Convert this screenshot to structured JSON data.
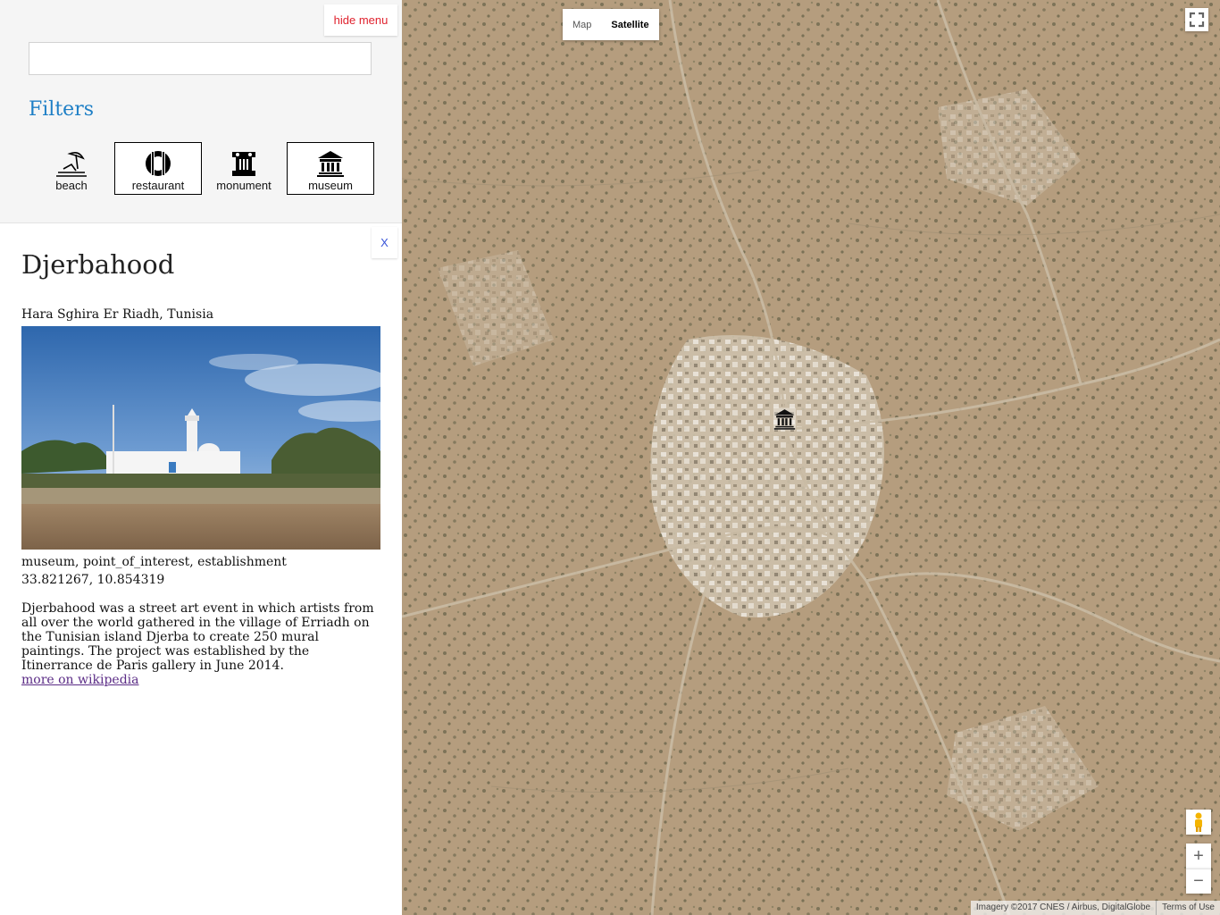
{
  "menu": {
    "hide_label": "hide menu",
    "search_value": "",
    "search_placeholder": "",
    "filters_title": "Filters",
    "filters": [
      {
        "label": "beach",
        "icon": "beach-umbrella-icon",
        "active": false
      },
      {
        "label": "restaurant",
        "icon": "cutlery-icon",
        "active": true
      },
      {
        "label": "monument",
        "icon": "column-icon",
        "active": false
      },
      {
        "label": "museum",
        "icon": "museum-icon",
        "active": true
      }
    ]
  },
  "detail": {
    "close_label": "X",
    "title": "Djerbahood",
    "address": "Hara Sghira Er Riadh, Tunisia",
    "types": "museum, point_of_interest, establishment",
    "coords": "33.821267, 10.854319",
    "description": "Djerbahood was a street art event in which artists from all over the world gathered in the village of Erriadh on the Tunisian island Djerba to create 250 mural paintings. The project was established by the Itinerrance de Paris gallery in June 2014.",
    "link_label": "more on wikipedia"
  },
  "map": {
    "types": [
      "Map",
      "Satellite"
    ],
    "selected_type": "Satellite",
    "zoom_in": "+",
    "zoom_out": "−",
    "attribution": "Imagery ©2017 CNES / Airbus, DigitalGlobe",
    "terms": "Terms of Use",
    "marker_icon": "museum-icon"
  },
  "colors": {
    "filters_title": "#1e7fc6",
    "hide_menu_text": "#e0222e",
    "close_text": "#3a55d8",
    "link_visited": "#5b2c86",
    "menu_bg": "#f5f5f5"
  }
}
